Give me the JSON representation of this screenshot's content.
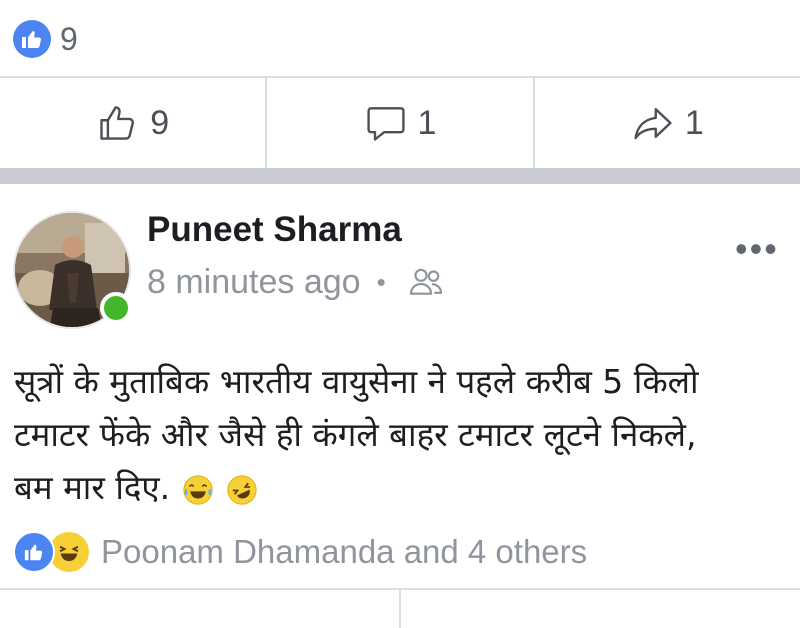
{
  "prev_post": {
    "reaction_count": "9",
    "actions": [
      {
        "icon": "thumbs-up-outline-icon",
        "count": "9"
      },
      {
        "icon": "comment-icon",
        "count": "1"
      },
      {
        "icon": "share-icon",
        "count": "1"
      }
    ]
  },
  "post": {
    "author": "Puneet Sharma",
    "timestamp": "8 minutes ago",
    "separator": "•",
    "audience_icon": "friends-icon",
    "more_label": "•••",
    "text_lines": [
      "सूत्रों के मुताबिक भारतीय वायुसेना ने पहले करीब 5 किलो",
      "टमाटर फेंके और जैसे ही कंगले बाहर टमाटर लूटने निकले,",
      "बम मार दिए."
    ],
    "reactions_summary": "Poonam Dhamanda and 4 others"
  },
  "colors": {
    "facebook_blue": "#4c84f2",
    "online_green": "#42b72a",
    "haha_yellow": "#f7d038",
    "meta_gray": "#90949c"
  }
}
